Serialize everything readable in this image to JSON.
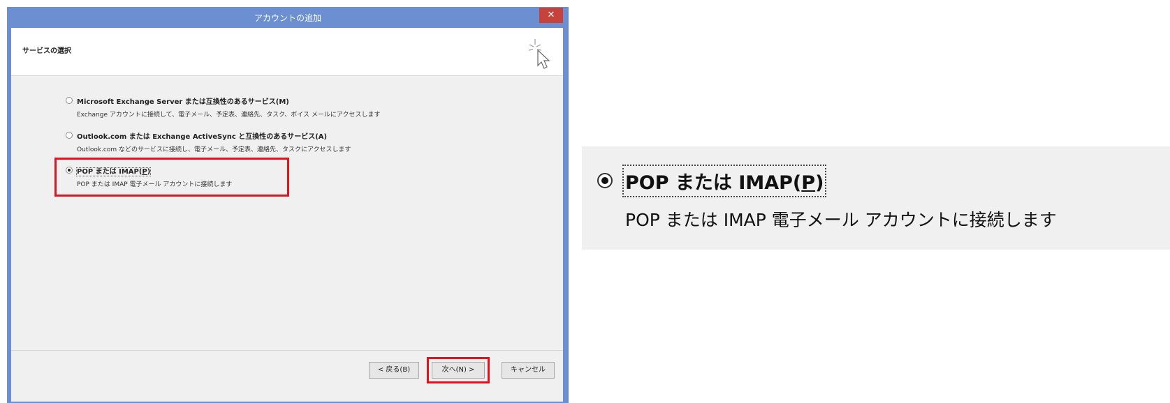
{
  "window": {
    "title": "アカウントの追加",
    "close_glyph": "✕"
  },
  "header": {
    "title": "サービスの選択",
    "icon": "wizard-cursor-sparkle-icon"
  },
  "options": [
    {
      "label": "Microsoft Exchange Server または互換性のあるサービス(M)",
      "description": "Exchange アカウントに接続して、電子メール、予定表、連絡先、タスク、ボイス メールにアクセスします",
      "checked": false
    },
    {
      "label": "Outlook.com または Exchange ActiveSync と互換性のあるサービス(A)",
      "description": "Outlook.com などのサービスに接続し、電子メール、予定表、連絡先、タスクにアクセスします",
      "checked": false
    },
    {
      "label_main": "POP または IMAP(",
      "label_key": "P",
      "label_end": ")",
      "description": "POP または IMAP 電子メール アカウントに接続します",
      "checked": true
    }
  ],
  "buttons": {
    "back": "< 戻る(B)",
    "next": "次へ(N) >",
    "cancel": "キャンセル"
  },
  "highlight_color": "#e0141e",
  "zoom": {
    "label_main": "POP または IMAP(",
    "label_key": "P",
    "label_end": ")",
    "description": "POP または IMAP 電子メール アカウントに接続します"
  }
}
